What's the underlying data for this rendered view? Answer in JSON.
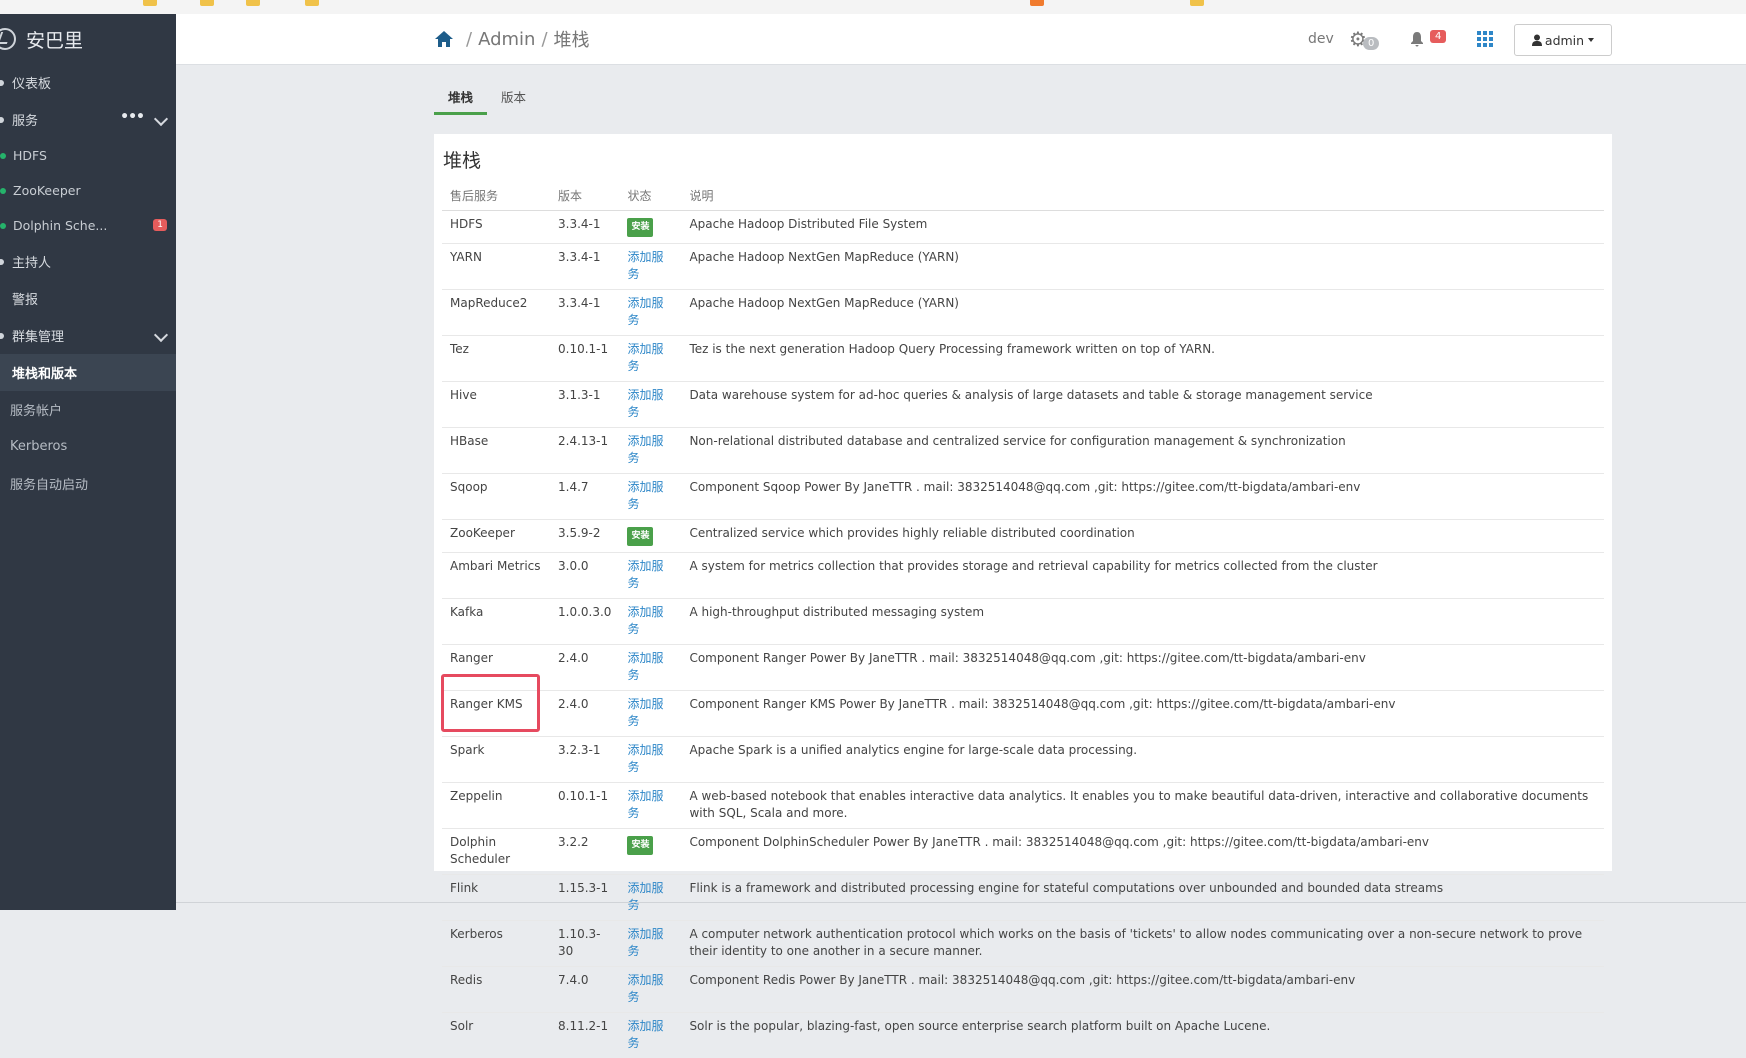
{
  "app": {
    "brand": "安巴里"
  },
  "colors": {
    "sidebar_bg": "#303844",
    "accent": "#2e87c8",
    "installed_green": "#4aa04a",
    "alert_red": "#e65c5c",
    "highlight": "#e64a5f"
  },
  "sidebar": {
    "items": [
      {
        "label": "仪表板"
      },
      {
        "label": "服务"
      },
      {
        "label": "HDFS"
      },
      {
        "label": "ZooKeeper"
      },
      {
        "label": "Dolphin Sche...",
        "badge": "1"
      },
      {
        "label": "主持人"
      },
      {
        "label": "警报"
      },
      {
        "label": "群集管理"
      },
      {
        "label": "堆栈和版本"
      },
      {
        "label": "服务帐户"
      },
      {
        "label": "Kerberos"
      },
      {
        "label": "服务自动启动"
      }
    ]
  },
  "header": {
    "breadcrumb": [
      "Admin",
      "堆栈"
    ],
    "env_label": "dev",
    "ops_count": "0",
    "alerts_count": "4",
    "user_label": "admin"
  },
  "tabs": [
    "堆栈",
    "版本"
  ],
  "panel": {
    "title": "堆栈",
    "columns": [
      "售后服务",
      "版本",
      "状态",
      "说明"
    ],
    "rows": [
      {
        "service": "HDFS",
        "version": "3.3.4-1",
        "status": "安装",
        "installed": true,
        "description": "Apache Hadoop Distributed File System"
      },
      {
        "service": "YARN",
        "version": "3.3.4-1",
        "status": "添加服务",
        "installed": false,
        "description": "Apache Hadoop NextGen MapReduce (YARN)"
      },
      {
        "service": "MapReduce2",
        "version": "3.3.4-1",
        "status": "添加服务",
        "installed": false,
        "description": "Apache Hadoop NextGen MapReduce (YARN)"
      },
      {
        "service": "Tez",
        "version": "0.10.1-1",
        "status": "添加服务",
        "installed": false,
        "description": "Tez is the next generation Hadoop Query Processing framework written on top of YARN."
      },
      {
        "service": "Hive",
        "version": "3.1.3-1",
        "status": "添加服务",
        "installed": false,
        "description": "Data warehouse system for ad-hoc queries & analysis of large datasets and table & storage management service"
      },
      {
        "service": "HBase",
        "version": "2.4.13-1",
        "status": "添加服务",
        "installed": false,
        "description": "Non-relational distributed database and centralized service for configuration management & synchronization"
      },
      {
        "service": "Sqoop",
        "version": "1.4.7",
        "status": "添加服务",
        "installed": false,
        "description": "Component Sqoop Power By JaneTTR . mail: 3832514048@qq.com ,git: https://gitee.com/tt-bigdata/ambari-env"
      },
      {
        "service": "ZooKeeper",
        "version": "3.5.9-2",
        "status": "安装",
        "installed": true,
        "description": "Centralized service which provides highly reliable distributed coordination"
      },
      {
        "service": "Ambari Metrics",
        "version": "3.0.0",
        "status": "添加服务",
        "installed": false,
        "description": "A system for metrics collection that provides storage and retrieval capability for metrics collected from the cluster"
      },
      {
        "service": "Kafka",
        "version": "1.0.0.3.0",
        "status": "添加服务",
        "installed": false,
        "description": "A high-throughput distributed messaging system"
      },
      {
        "service": "Ranger",
        "version": "2.4.0",
        "status": "添加服务",
        "installed": false,
        "description": "Component Ranger Power By JaneTTR . mail: 3832514048@qq.com ,git: https://gitee.com/tt-bigdata/ambari-env"
      },
      {
        "service": "Ranger KMS",
        "version": "2.4.0",
        "status": "添加服务",
        "installed": false,
        "description": "Component Ranger KMS Power By JaneTTR . mail: 3832514048@qq.com ,git: https://gitee.com/tt-bigdata/ambari-env"
      },
      {
        "service": "Spark",
        "version": "3.2.3-1",
        "status": "添加服务",
        "installed": false,
        "description": "Apache Spark is a unified analytics engine for large-scale data processing."
      },
      {
        "service": "Zeppelin",
        "version": "0.10.1-1",
        "status": "添加服务",
        "installed": false,
        "description": "A web-based notebook that enables interactive data analytics. It enables you to make beautiful data-driven, interactive and collaborative documents with SQL, Scala and more."
      },
      {
        "service": "Dolphin Scheduler",
        "version": "3.2.2",
        "status": "安装",
        "installed": true,
        "description": "Component DolphinScheduler Power By JaneTTR . mail: 3832514048@qq.com ,git: https://gitee.com/tt-bigdata/ambari-env"
      },
      {
        "service": "Flink",
        "version": "1.15.3-1",
        "status": "添加服务",
        "installed": false,
        "description": "Flink is a framework and distributed processing engine for stateful computations over unbounded and bounded data streams"
      },
      {
        "service": "Kerberos",
        "version": "1.10.3-30",
        "status": "添加服务",
        "installed": false,
        "description": "A computer network authentication protocol which works on the basis of 'tickets' to allow nodes communicating over a non-secure network to prove their identity to one another in a secure manner."
      },
      {
        "service": "Redis",
        "version": "7.4.0",
        "status": "添加服务",
        "installed": false,
        "description": "Component Redis Power By JaneTTR . mail: 3832514048@qq.com ,git: https://gitee.com/tt-bigdata/ambari-env"
      },
      {
        "service": "Solr",
        "version": "8.11.2-1",
        "status": "添加服务",
        "installed": false,
        "description": "Solr is the popular, blazing-fast, open source enterprise search platform built on Apache Lucene."
      }
    ]
  }
}
